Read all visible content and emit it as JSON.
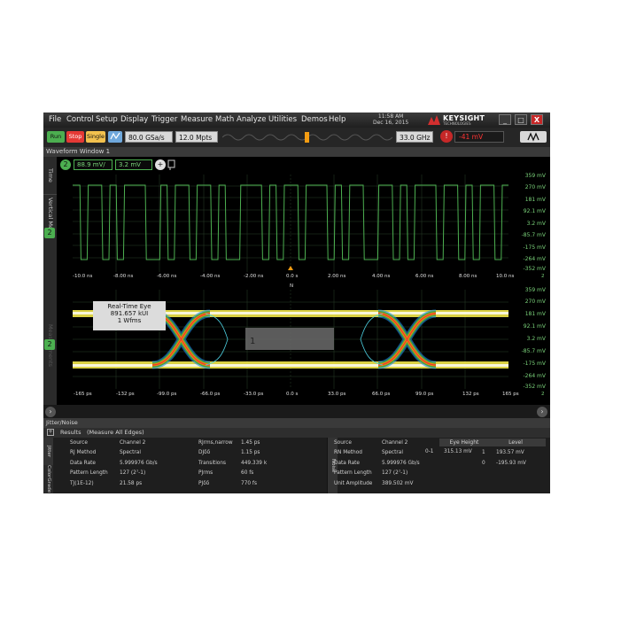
{
  "menu": [
    "File",
    "Control",
    "Setup",
    "Display",
    "Trigger",
    "Measure",
    "Math",
    "Analyze",
    "Utilities",
    "Demos",
    "Help"
  ],
  "clock": {
    "time": "11:58 AM",
    "date": "Dec 16, 2015"
  },
  "brand": {
    "name": "KEYSIGHT",
    "sub": "TECHNOLOGIES"
  },
  "window_buttons": [
    "_",
    "□",
    "X"
  ],
  "toolbar": {
    "run": "Run",
    "stop": "Stop",
    "single": "Single",
    "sample_rate": "80.0 GSa/s",
    "memory": "12.0 Mpts",
    "bandwidth": "33.0 GHz",
    "trigger_level": "-41 mV"
  },
  "window_title": "Waveform Window 1",
  "side_tabs": {
    "time_meas": "Time Meas",
    "vertical_meas": "Vertical Meas",
    "measurements": "Measurements"
  },
  "channel": {
    "scale": "88.9 mV/",
    "offset": "3.2 mV",
    "marker": "2"
  },
  "top_plot": {
    "voltage_labels": [
      "359 mV",
      "270 mV",
      "181 mV",
      "92.1 mV",
      "3.2 mV",
      "-85.7 mV",
      "-175 mV",
      "-264 mV",
      "-352 mV"
    ],
    "time_labels": [
      "-10.0 ns",
      "-8.00 ns",
      "-6.00 ns",
      "-4.00 ns",
      "-2.00 ns",
      "0.0 s",
      "2.00 ns",
      "4.00 ns",
      "6.00 ns",
      "8.00 ns",
      "10.0 ns"
    ],
    "axis_end": "2"
  },
  "eye_plot": {
    "voltage_labels": [
      "359 mV",
      "270 mV",
      "181 mV",
      "92.1 mV",
      "3.2 mV",
      "-85.7 mV",
      "-175 mV",
      "-264 mV",
      "-352 mV"
    ],
    "time_labels": [
      "-165 ps",
      "-132 ps",
      "-99.0 ps",
      "-66.0 ps",
      "-33.0 ps",
      "0.0 s",
      "33.0 ps",
      "66.0 ps",
      "99.0 ps",
      "132 ps",
      "165 ps"
    ],
    "axis_end": "2",
    "center_marker": "N",
    "mask_label": "1",
    "info": {
      "title": "Real-Time Eye",
      "kui": "891.657 kUI",
      "wfms": "1 Wfms"
    }
  },
  "jitter_bar": "Jitter/Noise",
  "results_bar": {
    "title": "Results",
    "subtitle": "(Measure All Edges)"
  },
  "jitter_side": "Jitter",
  "color_grade_side": "ColorGrade",
  "noise_side": "Noise",
  "jitter_table_left": [
    [
      "Source",
      "Channel 2"
    ],
    [
      "RJ Method",
      "Spectral"
    ],
    [
      "Data Rate",
      "5.999976 Gb/s"
    ],
    [
      "Pattern Length",
      "127 (2⁷-1)"
    ],
    [
      "TJ(1E-12)",
      "21.58 ps"
    ]
  ],
  "jitter_table_right": [
    [
      "RJrms,narrow",
      "1.45 ps"
    ],
    [
      "DJδδ",
      "1.15 ps"
    ],
    [
      "Transitions",
      "449.339 k"
    ],
    [
      "PJrms",
      "60 fs"
    ],
    [
      "PJδδ",
      "770 fs"
    ]
  ],
  "noise_table": [
    [
      "Source",
      "Channel 2"
    ],
    [
      "RN Method",
      "Spectral"
    ],
    [
      "Data Rate",
      "5.999976 Gb/s"
    ],
    [
      "Pattern Length",
      "127 (2⁷-1)"
    ],
    [
      "Unit Amplitude",
      "389.502 mV"
    ]
  ],
  "eye_height": {
    "header": "Eye Height",
    "row": "0-1",
    "value": "315.13 mV"
  },
  "level": {
    "header": "Level",
    "rows": [
      [
        "1",
        "193.57 mV"
      ],
      [
        "0",
        "-195.93 mV"
      ]
    ]
  },
  "colors": {
    "waveform": "#4caf50",
    "grid": "#2e4d2e",
    "background": "#000000"
  }
}
